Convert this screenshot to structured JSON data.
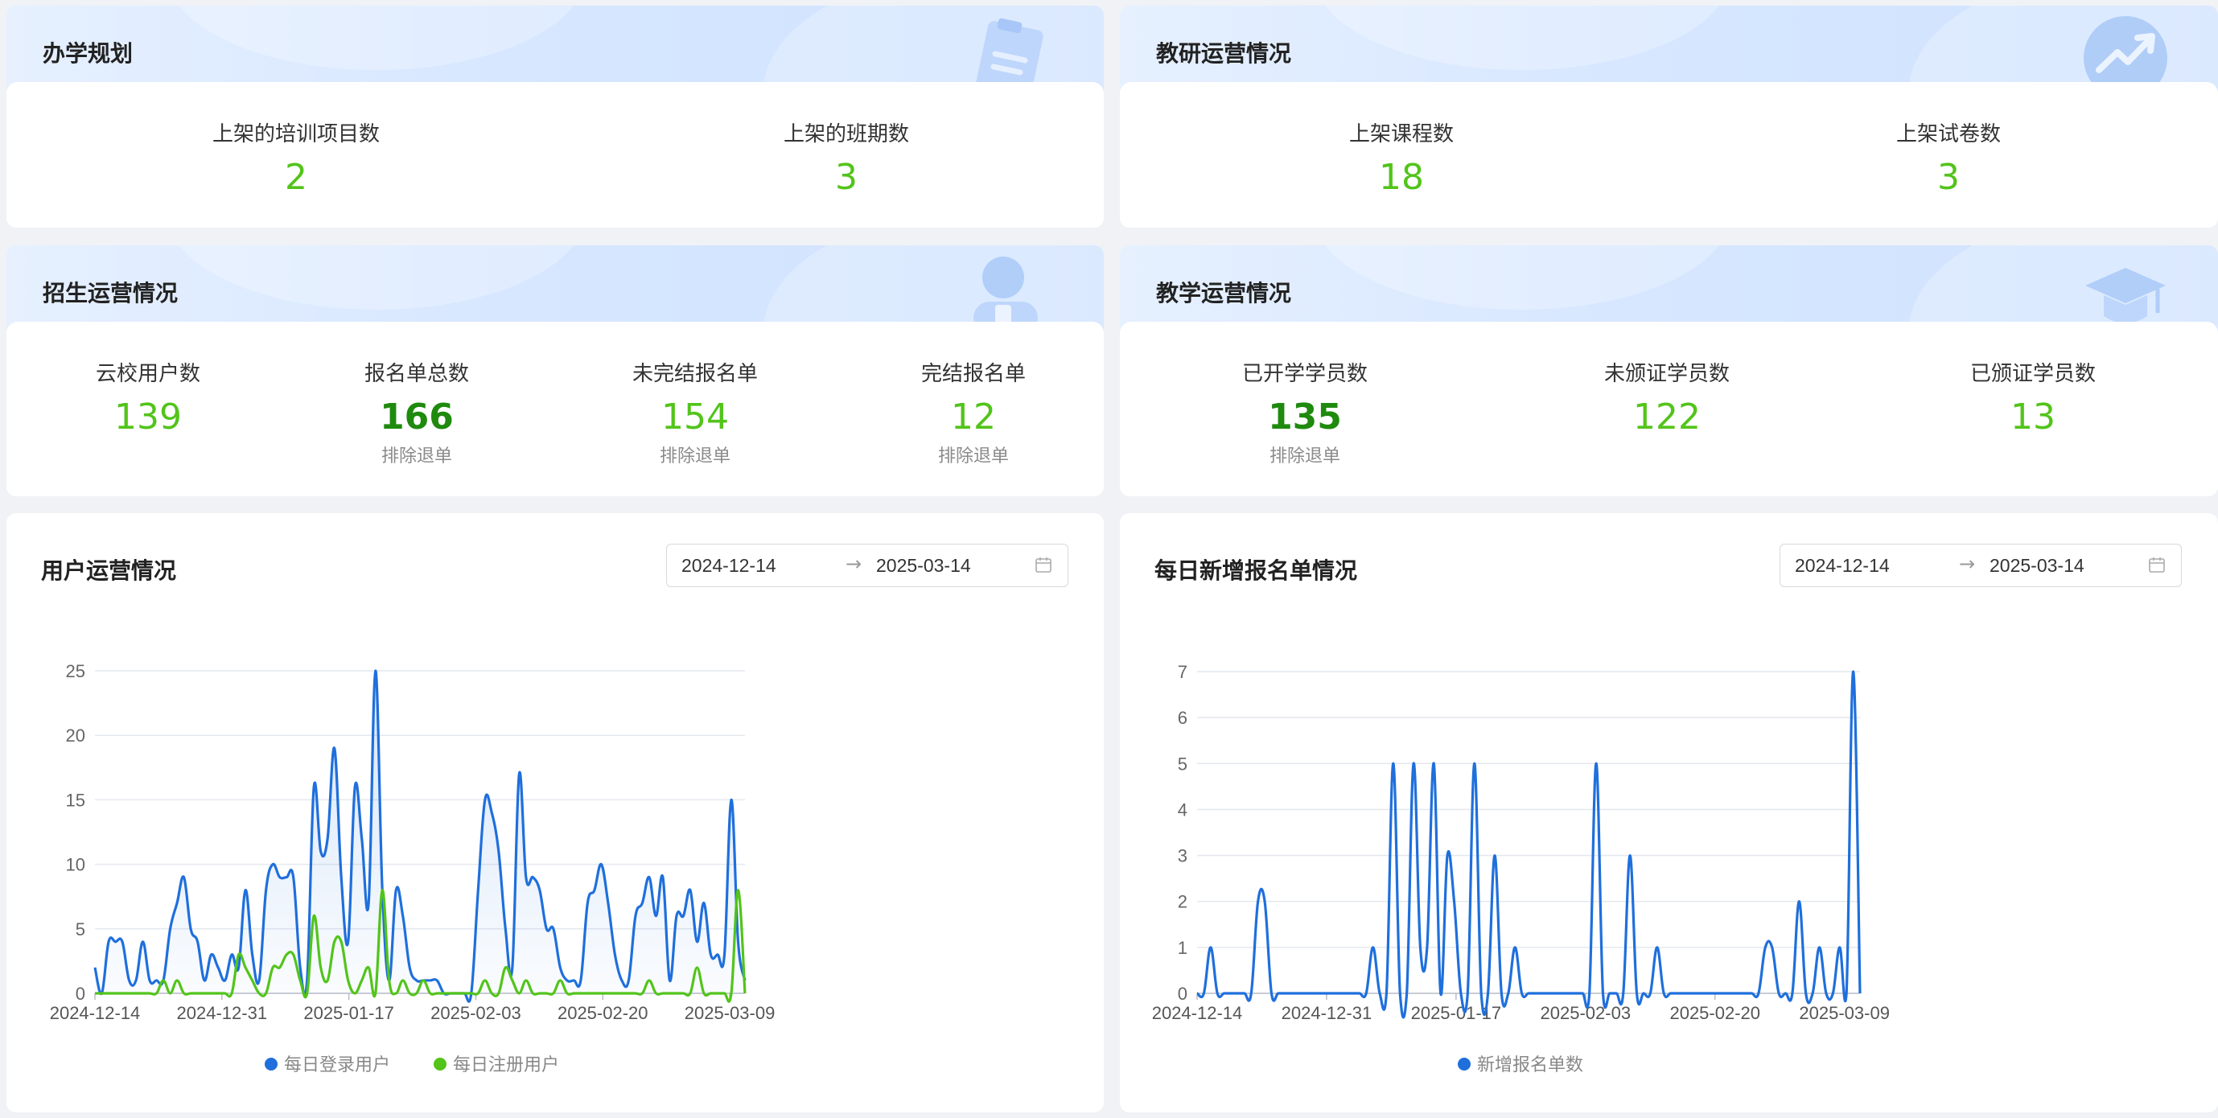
{
  "planning": {
    "title": "办学规划",
    "stats": [
      {
        "label": "上架的培训项目数",
        "value": "2"
      },
      {
        "label": "上架的班期数",
        "value": "3"
      }
    ]
  },
  "research": {
    "title": "教研运营情况",
    "stats": [
      {
        "label": "上架课程数",
        "value": "18"
      },
      {
        "label": "上架试卷数",
        "value": "3"
      }
    ]
  },
  "enrollment": {
    "title": "招生运营情况",
    "stats": [
      {
        "label": "云校用户数",
        "value": "139",
        "sub": ""
      },
      {
        "label": "报名单总数",
        "value": "166",
        "sub": "排除退单"
      },
      {
        "label": "未完结报名单",
        "value": "154",
        "sub": "排除退单"
      },
      {
        "label": "完结报名单",
        "value": "12",
        "sub": "排除退单"
      }
    ]
  },
  "teaching": {
    "title": "教学运营情况",
    "stats": [
      {
        "label": "已开学学员数",
        "value": "135",
        "sub": "排除退单"
      },
      {
        "label": "未颁证学员数",
        "value": "122",
        "sub": ""
      },
      {
        "label": "已颁证学员数",
        "value": "13",
        "sub": ""
      }
    ]
  },
  "user_chart": {
    "title": "用户运营情况",
    "start_date": "2024-12-14",
    "end_date": "2025-03-14"
  },
  "signup_chart": {
    "title": "每日新增报名单情况",
    "start_date": "2024-12-14",
    "end_date": "2025-03-14"
  },
  "range_separator": "→",
  "icons": {
    "calendar": "calendar-icon"
  },
  "colors": {
    "accent_green": "#52c41a",
    "dark_green": "#1f8a0e",
    "blue_series": "#1f6fdc",
    "green_series": "#52c41a"
  },
  "chart_data": [
    {
      "type": "area",
      "title": "",
      "x": [
        "2024-12-14",
        "2024-12-31",
        "2025-01-17",
        "2025-02-03",
        "2025-02-20",
        "2025-03-09"
      ],
      "ylim": [
        0,
        25
      ],
      "yticks": [
        "0",
        "5",
        "10",
        "15",
        "20",
        "25"
      ],
      "xticks": [
        "2024-12-14",
        "2024-12-31",
        "2025-01-17",
        "2025-02-03",
        "2025-02-20",
        "2025-03-09"
      ],
      "grid": true,
      "legend": "bottom",
      "series": [
        {
          "name": "每日登录用户",
          "color": "#1f6fdc",
          "values": [
            2,
            0,
            4,
            4,
            4,
            1,
            1,
            4,
            1,
            1,
            1,
            5,
            7,
            9,
            5,
            4,
            1,
            3,
            2,
            1,
            3,
            2,
            8,
            3,
            1,
            8,
            10,
            9,
            9,
            9,
            2,
            1,
            16,
            11,
            12,
            19,
            9,
            4,
            16,
            12,
            7,
            25,
            8,
            1,
            8,
            6,
            2,
            1,
            1,
            1,
            1,
            0,
            0,
            0,
            0,
            0,
            8,
            15,
            14,
            11,
            5,
            2,
            17,
            9,
            9,
            8,
            5,
            5,
            2,
            1,
            1,
            1,
            7,
            8,
            10,
            7,
            3,
            1,
            1,
            6,
            7,
            9,
            6,
            9,
            1,
            6,
            6,
            8,
            4,
            7,
            3,
            3,
            3,
            15,
            4,
            1
          ]
        },
        {
          "name": "每日注册用户",
          "color": "#52c41a",
          "values": [
            0,
            0,
            0,
            0,
            0,
            0,
            0,
            0,
            0,
            0,
            1,
            0,
            1,
            0,
            0,
            0,
            0,
            0,
            0,
            0,
            0,
            3,
            2,
            1,
            0,
            0,
            2,
            2,
            3,
            3,
            1,
            0,
            6,
            2,
            1,
            4,
            4,
            1,
            0,
            1,
            2,
            0,
            8,
            1,
            0,
            1,
            0,
            0,
            1,
            0,
            0,
            0,
            0,
            0,
            0,
            0,
            0,
            1,
            0,
            0,
            2,
            1,
            0,
            1,
            0,
            0,
            0,
            0,
            1,
            0,
            0,
            0,
            0,
            0,
            0,
            0,
            0,
            0,
            0,
            0,
            0,
            1,
            0,
            0,
            0,
            0,
            0,
            0,
            2,
            0,
            0,
            0,
            0,
            0,
            8,
            0
          ]
        }
      ]
    },
    {
      "type": "line",
      "title": "",
      "x": [
        "2024-12-14",
        "2024-12-31",
        "2025-01-17",
        "2025-02-03",
        "2025-02-20",
        "2025-03-09"
      ],
      "ylim": [
        0,
        7
      ],
      "yticks": [
        "0",
        "1",
        "2",
        "3",
        "4",
        "5",
        "6",
        "7"
      ],
      "xticks": [
        "2024-12-14",
        "2024-12-31",
        "2025-01-17",
        "2025-02-03",
        "2025-02-20",
        "2025-03-09"
      ],
      "grid": true,
      "legend": "bottom",
      "series": [
        {
          "name": "新增报名单数",
          "color": "#1f6fdc",
          "values": [
            0,
            0,
            1,
            0,
            0,
            0,
            0,
            0,
            0,
            2,
            2,
            0,
            0,
            0,
            0,
            0,
            0,
            0,
            0,
            0,
            0,
            0,
            0,
            0,
            0,
            0,
            1,
            0,
            0,
            5,
            0,
            0,
            5,
            1,
            1,
            5,
            0,
            3,
            2,
            0,
            0,
            5,
            0,
            0,
            3,
            0,
            0,
            1,
            0,
            0,
            0,
            0,
            0,
            0,
            0,
            0,
            0,
            0,
            0,
            5,
            0,
            0,
            0,
            0,
            3,
            0,
            0,
            0,
            1,
            0,
            0,
            0,
            0,
            0,
            0,
            0,
            0,
            0,
            0,
            0,
            0,
            0,
            0,
            0,
            1,
            1,
            0,
            0,
            0,
            2,
            0,
            0,
            1,
            0,
            0,
            1,
            0,
            7,
            0
          ]
        }
      ]
    }
  ]
}
